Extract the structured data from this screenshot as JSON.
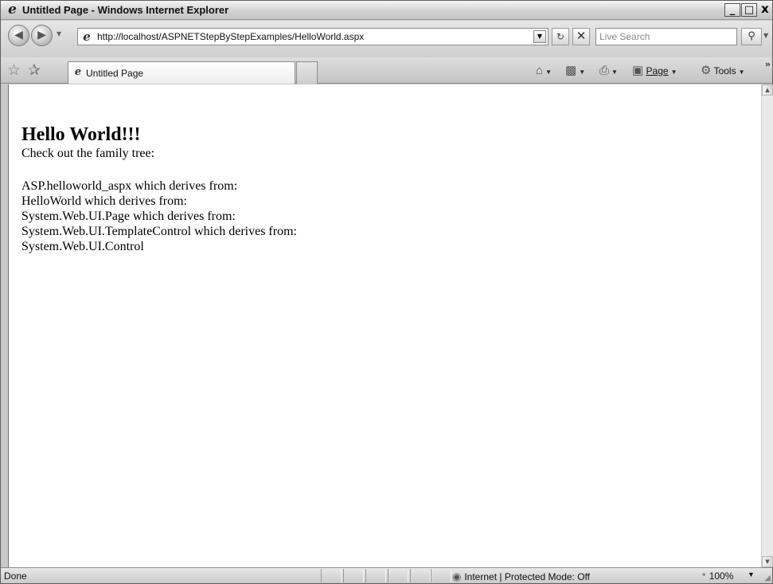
{
  "window": {
    "title": "Untitled Page - Windows Internet Explorer",
    "minimize": "_",
    "maximize": "□",
    "close": "x"
  },
  "toolbar": {
    "back_icon": "arrow-left-icon",
    "forward_icon": "arrow-right-icon",
    "address": "http://localhost/ASPNETStepByStepExamples/HelloWorld.aspx",
    "search_placeholder": "Live Search"
  },
  "tabs": [
    {
      "label": "Untitled Page",
      "active": true
    }
  ],
  "commands": {
    "home_icon": "home-icon",
    "feeds_icon": "feeds-icon",
    "print_icon": "print-icon",
    "page": "Page",
    "tools": "Tools"
  },
  "content": {
    "heading": "Hello World!!!",
    "intro": "Check out the family tree:",
    "tree": [
      "ASP.helloworld_aspx which derives from:",
      "HelloWorld which derives from:",
      "System.Web.UI.Page which derives from:",
      "System.Web.UI.TemplateControl which derives from:",
      "System.Web.UI.Control"
    ]
  },
  "status": {
    "text": "Done",
    "zone": "Internet | Protected Mode: Off",
    "zoom": "100%"
  },
  "colors": {
    "chrome": "#c9c9c9",
    "content_bg": "#ffffff"
  }
}
